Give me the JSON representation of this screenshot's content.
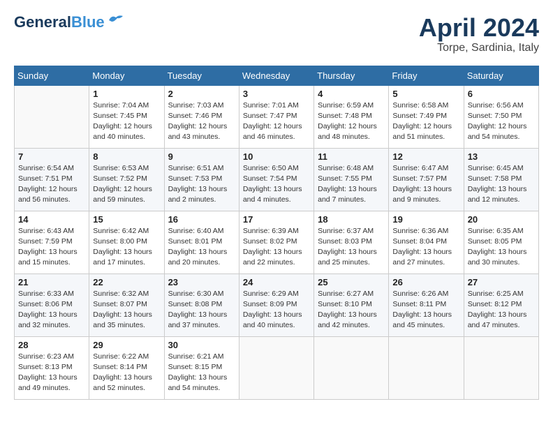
{
  "header": {
    "logo_line1": "General",
    "logo_line2": "Blue",
    "month_title": "April 2024",
    "location": "Torpe, Sardinia, Italy"
  },
  "days_of_week": [
    "Sunday",
    "Monday",
    "Tuesday",
    "Wednesday",
    "Thursday",
    "Friday",
    "Saturday"
  ],
  "weeks": [
    [
      {
        "day": "",
        "detail": ""
      },
      {
        "day": "1",
        "detail": "Sunrise: 7:04 AM\nSunset: 7:45 PM\nDaylight: 12 hours\nand 40 minutes."
      },
      {
        "day": "2",
        "detail": "Sunrise: 7:03 AM\nSunset: 7:46 PM\nDaylight: 12 hours\nand 43 minutes."
      },
      {
        "day": "3",
        "detail": "Sunrise: 7:01 AM\nSunset: 7:47 PM\nDaylight: 12 hours\nand 46 minutes."
      },
      {
        "day": "4",
        "detail": "Sunrise: 6:59 AM\nSunset: 7:48 PM\nDaylight: 12 hours\nand 48 minutes."
      },
      {
        "day": "5",
        "detail": "Sunrise: 6:58 AM\nSunset: 7:49 PM\nDaylight: 12 hours\nand 51 minutes."
      },
      {
        "day": "6",
        "detail": "Sunrise: 6:56 AM\nSunset: 7:50 PM\nDaylight: 12 hours\nand 54 minutes."
      }
    ],
    [
      {
        "day": "7",
        "detail": "Sunrise: 6:54 AM\nSunset: 7:51 PM\nDaylight: 12 hours\nand 56 minutes."
      },
      {
        "day": "8",
        "detail": "Sunrise: 6:53 AM\nSunset: 7:52 PM\nDaylight: 12 hours\nand 59 minutes."
      },
      {
        "day": "9",
        "detail": "Sunrise: 6:51 AM\nSunset: 7:53 PM\nDaylight: 13 hours\nand 2 minutes."
      },
      {
        "day": "10",
        "detail": "Sunrise: 6:50 AM\nSunset: 7:54 PM\nDaylight: 13 hours\nand 4 minutes."
      },
      {
        "day": "11",
        "detail": "Sunrise: 6:48 AM\nSunset: 7:55 PM\nDaylight: 13 hours\nand 7 minutes."
      },
      {
        "day": "12",
        "detail": "Sunrise: 6:47 AM\nSunset: 7:57 PM\nDaylight: 13 hours\nand 9 minutes."
      },
      {
        "day": "13",
        "detail": "Sunrise: 6:45 AM\nSunset: 7:58 PM\nDaylight: 13 hours\nand 12 minutes."
      }
    ],
    [
      {
        "day": "14",
        "detail": "Sunrise: 6:43 AM\nSunset: 7:59 PM\nDaylight: 13 hours\nand 15 minutes."
      },
      {
        "day": "15",
        "detail": "Sunrise: 6:42 AM\nSunset: 8:00 PM\nDaylight: 13 hours\nand 17 minutes."
      },
      {
        "day": "16",
        "detail": "Sunrise: 6:40 AM\nSunset: 8:01 PM\nDaylight: 13 hours\nand 20 minutes."
      },
      {
        "day": "17",
        "detail": "Sunrise: 6:39 AM\nSunset: 8:02 PM\nDaylight: 13 hours\nand 22 minutes."
      },
      {
        "day": "18",
        "detail": "Sunrise: 6:37 AM\nSunset: 8:03 PM\nDaylight: 13 hours\nand 25 minutes."
      },
      {
        "day": "19",
        "detail": "Sunrise: 6:36 AM\nSunset: 8:04 PM\nDaylight: 13 hours\nand 27 minutes."
      },
      {
        "day": "20",
        "detail": "Sunrise: 6:35 AM\nSunset: 8:05 PM\nDaylight: 13 hours\nand 30 minutes."
      }
    ],
    [
      {
        "day": "21",
        "detail": "Sunrise: 6:33 AM\nSunset: 8:06 PM\nDaylight: 13 hours\nand 32 minutes."
      },
      {
        "day": "22",
        "detail": "Sunrise: 6:32 AM\nSunset: 8:07 PM\nDaylight: 13 hours\nand 35 minutes."
      },
      {
        "day": "23",
        "detail": "Sunrise: 6:30 AM\nSunset: 8:08 PM\nDaylight: 13 hours\nand 37 minutes."
      },
      {
        "day": "24",
        "detail": "Sunrise: 6:29 AM\nSunset: 8:09 PM\nDaylight: 13 hours\nand 40 minutes."
      },
      {
        "day": "25",
        "detail": "Sunrise: 6:27 AM\nSunset: 8:10 PM\nDaylight: 13 hours\nand 42 minutes."
      },
      {
        "day": "26",
        "detail": "Sunrise: 6:26 AM\nSunset: 8:11 PM\nDaylight: 13 hours\nand 45 minutes."
      },
      {
        "day": "27",
        "detail": "Sunrise: 6:25 AM\nSunset: 8:12 PM\nDaylight: 13 hours\nand 47 minutes."
      }
    ],
    [
      {
        "day": "28",
        "detail": "Sunrise: 6:23 AM\nSunset: 8:13 PM\nDaylight: 13 hours\nand 49 minutes."
      },
      {
        "day": "29",
        "detail": "Sunrise: 6:22 AM\nSunset: 8:14 PM\nDaylight: 13 hours\nand 52 minutes."
      },
      {
        "day": "30",
        "detail": "Sunrise: 6:21 AM\nSunset: 8:15 PM\nDaylight: 13 hours\nand 54 minutes."
      },
      {
        "day": "",
        "detail": ""
      },
      {
        "day": "",
        "detail": ""
      },
      {
        "day": "",
        "detail": ""
      },
      {
        "day": "",
        "detail": ""
      }
    ]
  ]
}
